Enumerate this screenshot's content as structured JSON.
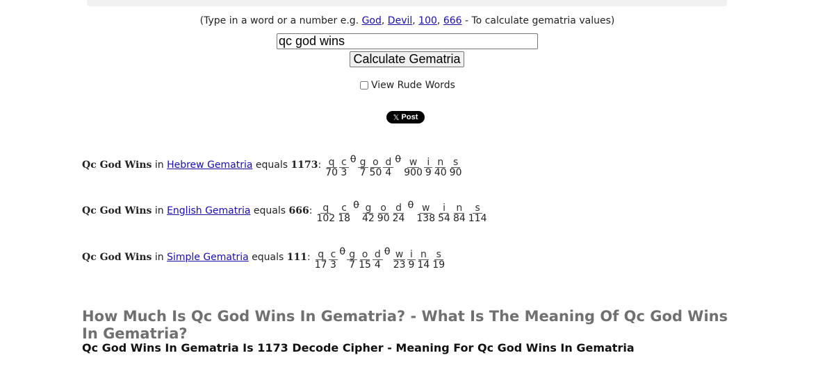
{
  "instructions": {
    "prefix": "(Type in a word or a number e.g. ",
    "examples": [
      "God",
      "Devil",
      "100",
      "666"
    ],
    "suffix": " - To calculate gematria values)"
  },
  "search": {
    "value": "qc god wins"
  },
  "calculate_label": "Calculate Gematria",
  "rude_words_label": "View Rude Words",
  "post_label": "Post",
  "phrase": "Qc God Wins",
  "results": [
    {
      "phrase": "Qc God Wins",
      "cipher": "Hebrew Gematria",
      "total": "1173",
      "letters": [
        {
          "ch": "q",
          "v": "70"
        },
        {
          "ch": "c",
          "v": "3"
        },
        {
          "ch": " ",
          "v": "0"
        },
        {
          "ch": "g",
          "v": "7"
        },
        {
          "ch": "o",
          "v": "50"
        },
        {
          "ch": "d",
          "v": "4"
        },
        {
          "ch": " ",
          "v": "0"
        },
        {
          "ch": "w",
          "v": "900"
        },
        {
          "ch": "i",
          "v": "9"
        },
        {
          "ch": "n",
          "v": "40"
        },
        {
          "ch": "s",
          "v": "90"
        }
      ]
    },
    {
      "phrase": "Qc God Wins",
      "cipher": "English Gematria",
      "total": "666",
      "letters": [
        {
          "ch": "q",
          "v": "102"
        },
        {
          "ch": "c",
          "v": "18"
        },
        {
          "ch": " ",
          "v": "0"
        },
        {
          "ch": "g",
          "v": "42"
        },
        {
          "ch": "o",
          "v": "90"
        },
        {
          "ch": "d",
          "v": "24"
        },
        {
          "ch": " ",
          "v": "0"
        },
        {
          "ch": "w",
          "v": "138"
        },
        {
          "ch": "i",
          "v": "54"
        },
        {
          "ch": "n",
          "v": "84"
        },
        {
          "ch": "s",
          "v": "114"
        }
      ]
    },
    {
      "phrase": "Qc God Wins",
      "cipher": "Simple Gematria",
      "total": "111",
      "letters": [
        {
          "ch": "q",
          "v": "17"
        },
        {
          "ch": "c",
          "v": "3"
        },
        {
          "ch": " ",
          "v": "0"
        },
        {
          "ch": "g",
          "v": "7"
        },
        {
          "ch": "o",
          "v": "15"
        },
        {
          "ch": "d",
          "v": "4"
        },
        {
          "ch": " ",
          "v": "0"
        },
        {
          "ch": "w",
          "v": "23"
        },
        {
          "ch": "i",
          "v": "9"
        },
        {
          "ch": "n",
          "v": "14"
        },
        {
          "ch": "s",
          "v": "19"
        }
      ]
    }
  ],
  "headline": "How Much Is Qc God Wins In Gematria? - What Is The Meaning Of Qc God Wins In Gematria?",
  "subhead": "Qc God Wins In Gematria Is 1173 Decode Cipher - Meaning For Qc God Wins In Gematria",
  "colors": {
    "link": "#1a0dab",
    "headline": "#707070",
    "post_bg": "#000000"
  }
}
